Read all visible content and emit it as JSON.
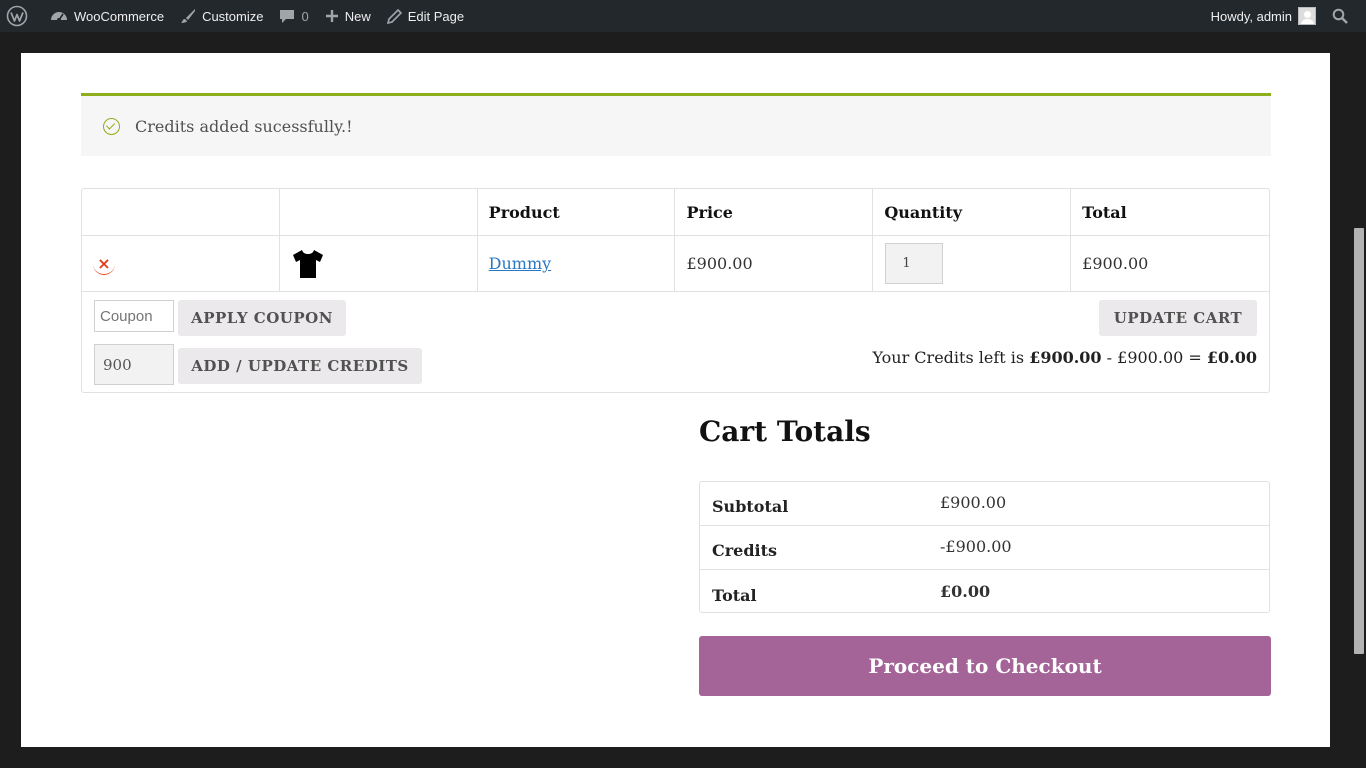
{
  "adminbar": {
    "wordpress_icon": "wordpress-logo-icon",
    "items": [
      {
        "label": "WooCommerce",
        "icon": "dashboard-icon"
      },
      {
        "label": "Customize",
        "icon": "brush-icon"
      },
      {
        "label": "0",
        "icon": "comment-icon"
      },
      {
        "label": "New",
        "icon": "plus-icon"
      },
      {
        "label": "Edit Page",
        "icon": "pencil-icon"
      }
    ],
    "greeting": "Howdy, admin",
    "search_icon": "search-icon"
  },
  "notice": {
    "message": "Credits added sucessfully.!",
    "icon": "check-circle-icon",
    "accent": "#8fae1b"
  },
  "cart": {
    "headers": [
      "",
      "",
      "Product",
      "Price",
      "Quantity",
      "Total"
    ],
    "items": [
      {
        "product": "Dummy",
        "price": "£900.00",
        "quantity": "1",
        "total": "£900.00",
        "thumbnail": "tshirt-icon",
        "remove_icon": "remove-icon"
      }
    ],
    "coupon_placeholder": "Coupon",
    "apply_coupon_label": "APPLY COUPON",
    "credits_value": "900",
    "add_credits_label": "ADD / UPDATE CREDITS",
    "update_cart_label": "UPDATE CART",
    "credits_line": {
      "prefix": "Your Credits left is ",
      "available": "£900.00",
      "minus": " - ",
      "used": "£900.00",
      "equals": " = ",
      "remaining": "£0.00"
    }
  },
  "totals": {
    "title": "Cart Totals",
    "rows": [
      {
        "label": "Subtotal",
        "value": "£900.00"
      },
      {
        "label": "Credits",
        "value": "-£900.00"
      },
      {
        "label": "Total",
        "value": "£0.00"
      }
    ],
    "checkout_label": "Proceed to Checkout",
    "checkout_color": "#a46497"
  }
}
